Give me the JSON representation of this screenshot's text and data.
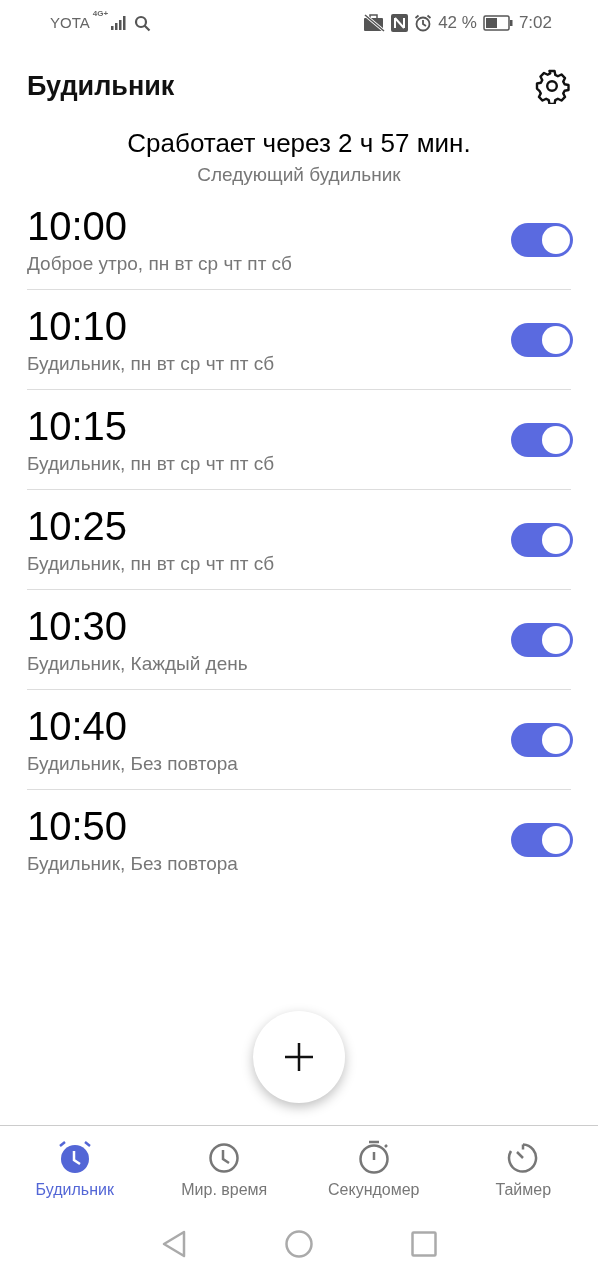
{
  "status_bar": {
    "carrier": "YOTA",
    "network": "4G+",
    "battery_percent": "42 %",
    "time": "7:02"
  },
  "header": {
    "title": "Будильник"
  },
  "summary": {
    "title": "Сработает через 2 ч 57 мин.",
    "subtitle": "Следующий будильник"
  },
  "alarms": [
    {
      "time": "10:00",
      "label": "Доброе утро, пн вт ср чт пт сб",
      "on": true
    },
    {
      "time": "10:10",
      "label": "Будильник, пн вт ср чт пт сб",
      "on": true
    },
    {
      "time": "10:15",
      "label": "Будильник, пн вт ср чт пт сб",
      "on": true
    },
    {
      "time": "10:25",
      "label": "Будильник, пн вт ср чт пт сб",
      "on": true
    },
    {
      "time": "10:30",
      "label": "Будильник, Каждый день",
      "on": true
    },
    {
      "time": "10:40",
      "label": "Будильник, Без повтора",
      "on": true
    },
    {
      "time": "10:50",
      "label": "Будильник, Без повтора",
      "on": true
    }
  ],
  "tabs": [
    {
      "label": "Будильник",
      "selected": true
    },
    {
      "label": "Мир. время",
      "selected": false
    },
    {
      "label": "Секундомер",
      "selected": false
    },
    {
      "label": "Таймер",
      "selected": false
    }
  ]
}
